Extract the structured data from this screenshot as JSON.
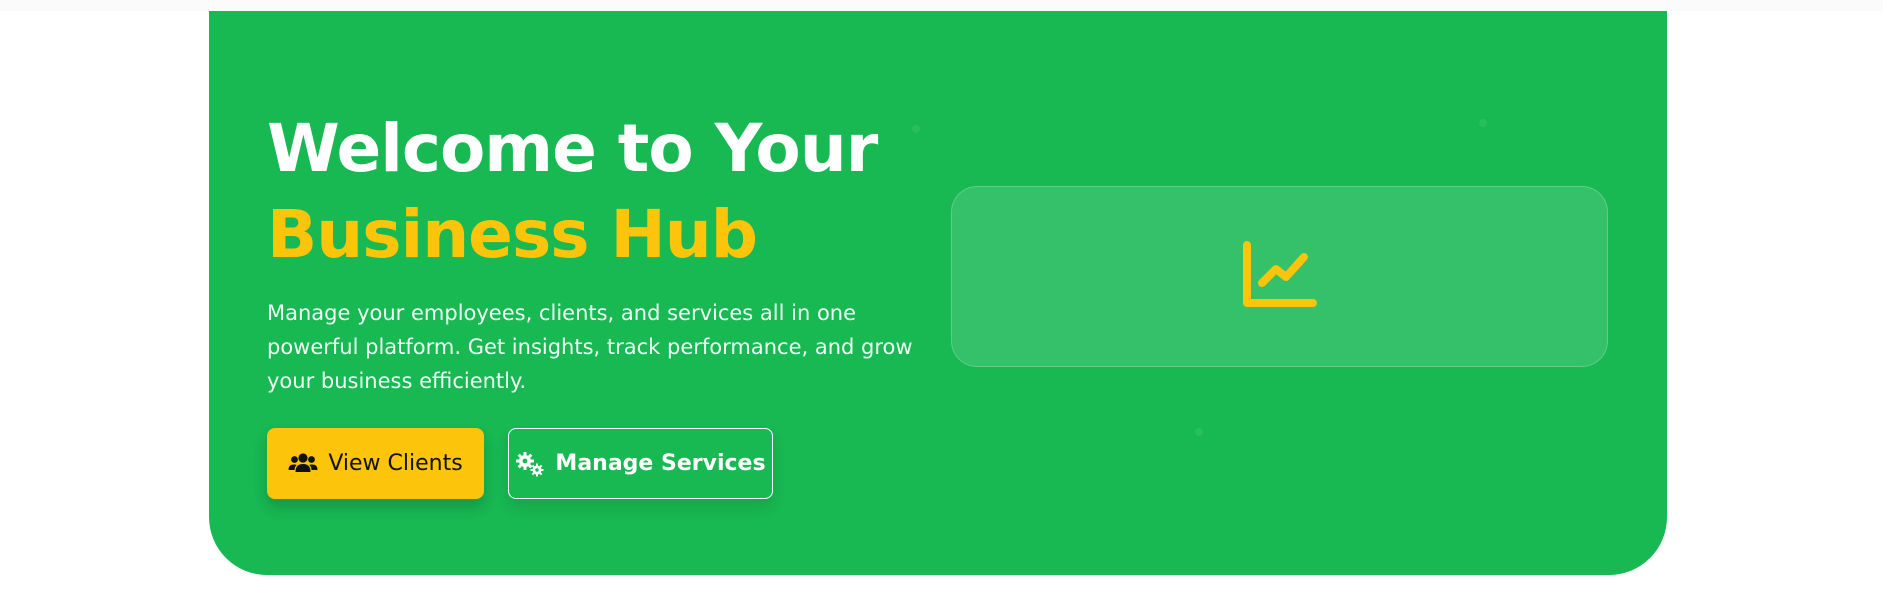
{
  "hero": {
    "title_line1": "Welcome to Your",
    "title_line2": "Business Hub",
    "description": "Manage your employees, clients, and services all in one powerful platform. Get insights, track performance, and grow your business efficiently.",
    "primary_button": {
      "label": "View Clients",
      "icon": "users-icon"
    },
    "secondary_button": {
      "label": "Manage Services",
      "icon": "gears-icon"
    },
    "feature_card": {
      "icon": "chart-line-icon"
    }
  },
  "colors": {
    "hero_background": "#18b853",
    "accent": "#fcc40a",
    "text_light": "#ffffff"
  }
}
